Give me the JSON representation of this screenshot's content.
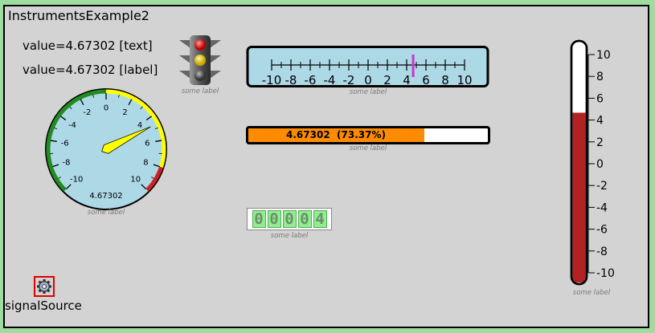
{
  "window": {
    "title": "InstrumentsExample2"
  },
  "value_text": "value=4.67302 [text]",
  "value_label": "value=4.67302 [label]",
  "value": 4.67302,
  "traffic_light": {
    "caption": "some label",
    "active": "all"
  },
  "linear_gauge": {
    "caption": "some label",
    "ticks": [
      "-10",
      "-8",
      "-6",
      "-4",
      "-2",
      "0",
      "2",
      "4",
      "6",
      "8",
      "10"
    ],
    "min": -10,
    "max": 10,
    "value": 4.67302,
    "needle_color": "#cc33cc"
  },
  "progress_bar": {
    "caption": "some label",
    "text": "4.67302  (73.37%)",
    "fraction": 0.7337,
    "fill_color": "#ff8c00"
  },
  "gauge": {
    "caption": "some label",
    "ticks": [
      "-10",
      "-8",
      "-6",
      "-4",
      "-2",
      "0",
      "2",
      "4",
      "6",
      "8",
      "10"
    ],
    "min": -10,
    "max": 10,
    "value": 4.67302,
    "readout": "4.67302",
    "face_color": "#add8e6",
    "needle_color": "#ffff00",
    "zones": [
      {
        "from": -10,
        "to": 0,
        "color": "#228b22"
      },
      {
        "from": 0,
        "to": 5,
        "color": "#ffff00"
      },
      {
        "from": 5,
        "to": 8,
        "color": "#ffff00"
      },
      {
        "from": 8,
        "to": 10,
        "color": "#cc2222"
      }
    ]
  },
  "counter": {
    "caption": "some label",
    "digits": [
      "0",
      "0",
      "0",
      "0",
      "4"
    ]
  },
  "thermometer": {
    "caption": "some label",
    "ticks": [
      "10",
      "8",
      "6",
      "4",
      "2",
      "0",
      "-2",
      "-4",
      "-6",
      "-8",
      "-10"
    ],
    "min": -10,
    "max": 10,
    "value": 4.67302,
    "fill_color": "#b22222"
  },
  "signal_source": {
    "label": "signalSource",
    "icon": "gear-icon"
  }
}
